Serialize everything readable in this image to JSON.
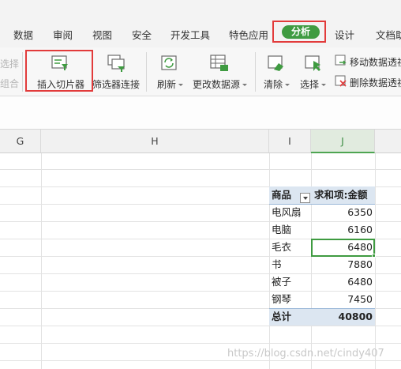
{
  "tabs": [
    "数据",
    "审阅",
    "视图",
    "安全",
    "开发工具",
    "特色应用",
    "分析",
    "设计",
    "文档助"
  ],
  "ribbon": {
    "partial_top": "选择",
    "partial_bottom": "组合",
    "insert_slicer": "插入切片器",
    "filter_connection": "筛选器连接",
    "refresh": "刷新",
    "change_source": "更改数据源",
    "clear": "清除",
    "select": "选择",
    "move_pivot": "移动数据透视",
    "delete_pivot": "删除数据透视"
  },
  "columns": [
    "G",
    "H",
    "I",
    "J"
  ],
  "selected_column": "J",
  "pivot": {
    "header_item": "商品",
    "header_value": "求和项:金额",
    "rows": [
      {
        "item": "电风扇",
        "value": "6350"
      },
      {
        "item": "电脑",
        "value": "6160"
      },
      {
        "item": "毛衣",
        "value": "6480"
      },
      {
        "item": "书",
        "value": "7880"
      },
      {
        "item": "被子",
        "value": "6480"
      },
      {
        "item": "钢琴",
        "value": "7450"
      }
    ],
    "total_label": "总计",
    "total_value": "40800"
  },
  "watermark": "https://blog.csdn.net/cindy407",
  "colors": {
    "accent_green": "#3f9b41",
    "highlight_red": "#e23b3b",
    "pivot_blue": "#dce6f1"
  }
}
